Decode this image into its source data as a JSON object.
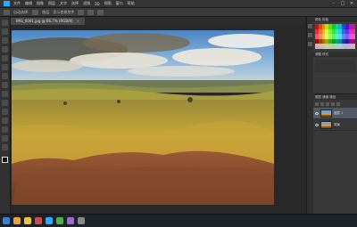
{
  "menu": {
    "items": [
      "文件",
      "编辑",
      "图像",
      "图层",
      "文字",
      "选择",
      "滤镜",
      "3D",
      "视图",
      "窗口",
      "帮助"
    ]
  },
  "options": {
    "texts": [
      "自动选择:",
      "图层",
      "显示变换控件"
    ]
  },
  "document": {
    "tab_label": "IMG_0001.jpg @ 66.7% (RGB/8)",
    "close_glyph": "×"
  },
  "panels": {
    "color_header": "颜色  色板",
    "adjust_header": "调整  样式",
    "layers_header": "图层  通道  路径"
  },
  "layers": [
    {
      "name": "图层 1"
    },
    {
      "name": "背景"
    }
  ],
  "colors": {
    "accent": "#31a8ff",
    "layer_selected": "#4f5a66"
  },
  "taskbar": {
    "icons": [
      "start-icon",
      "browser-icon",
      "folder-icon",
      "media-icon",
      "photoshop-icon",
      "chat-icon",
      "mail-icon",
      "settings-icon"
    ]
  }
}
